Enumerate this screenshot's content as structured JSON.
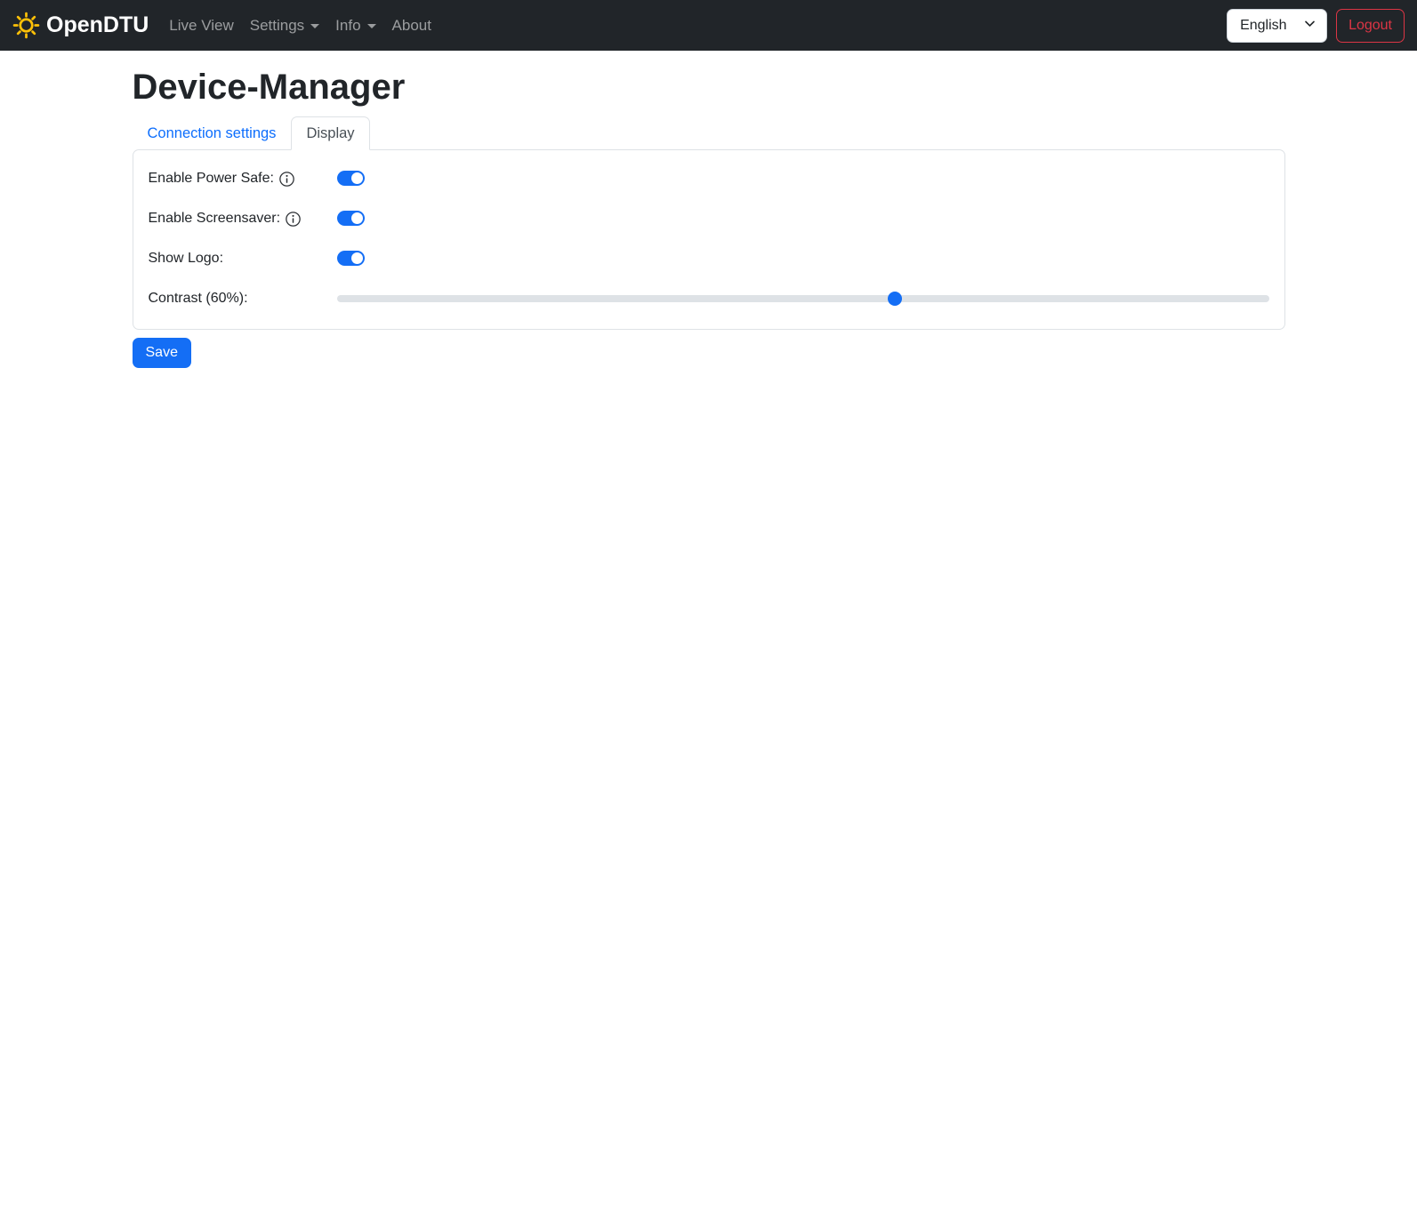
{
  "navbar": {
    "brand": "OpenDTU",
    "links": [
      {
        "label": "Live View",
        "dropdown": false
      },
      {
        "label": "Settings",
        "dropdown": true
      },
      {
        "label": "Info",
        "dropdown": true
      },
      {
        "label": "About",
        "dropdown": false
      }
    ],
    "language_selected": "English",
    "logout_label": "Logout"
  },
  "page": {
    "title": "Device-Manager"
  },
  "tabs": {
    "connection_label": "Connection settings",
    "display_label": "Display",
    "active": "Display"
  },
  "form": {
    "rows": [
      {
        "label": "Enable Power Safe:",
        "type": "switch",
        "value": true,
        "has_info": true
      },
      {
        "label": "Enable Screensaver:",
        "type": "switch",
        "value": true,
        "has_info": true
      },
      {
        "label": "Show Logo:",
        "type": "switch",
        "value": true,
        "has_info": false
      },
      {
        "label": "Contrast (60%):",
        "type": "range",
        "value": 60,
        "min": 0,
        "max": 100
      }
    ],
    "save_label": "Save"
  },
  "colors": {
    "navbar_bg": "#212529",
    "accent_blue": "#146ef5",
    "danger_red": "#dc3545",
    "brand_icon_yellow": "#ffc107",
    "border_gray": "#dee2e6",
    "nav_link_gray": "rgba(255,255,255,0.55)"
  }
}
